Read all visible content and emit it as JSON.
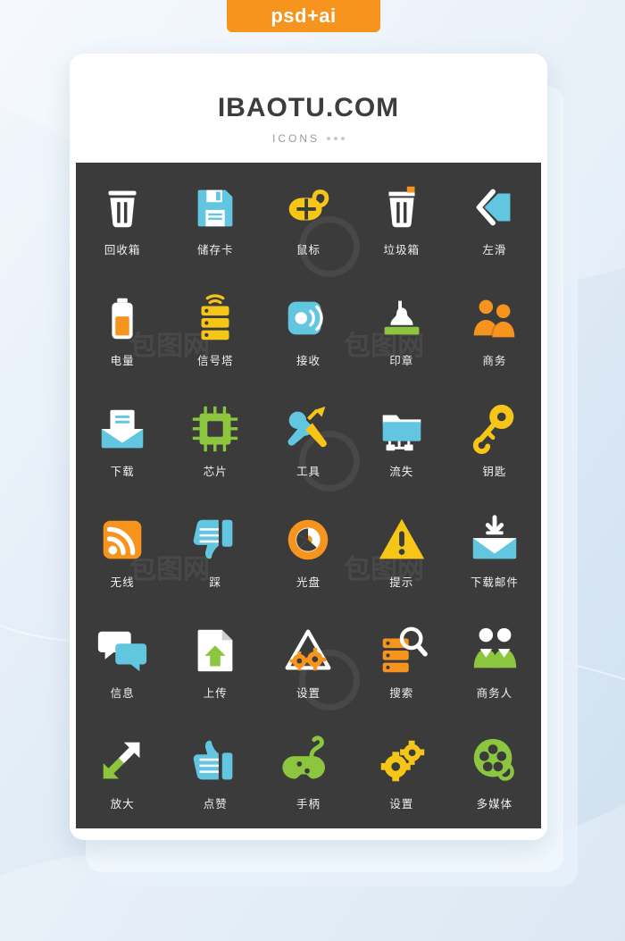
{
  "badge": {
    "label": "psd+ai"
  },
  "card": {
    "brand": "IBAOTU.COM",
    "subtitle": "ICONS"
  },
  "watermark": {
    "text": "包图网",
    "ring": "circle-watermark"
  },
  "colors": {
    "accent_orange": "#f7941e",
    "panel_dark": "#3b3b3b",
    "icon_blue": "#63c6e0",
    "icon_yellow": "#f5c518",
    "icon_green": "#8cc63f",
    "icon_orange": "#f7941e",
    "icon_white": "#ffffff",
    "page_bg": "#dfe9f5"
  },
  "icons": [
    {
      "label": "回收箱",
      "name": "recycle-bin-icon"
    },
    {
      "label": "储存卡",
      "name": "memory-card-icon"
    },
    {
      "label": "鼠标",
      "name": "mouse-icon"
    },
    {
      "label": "垃圾箱",
      "name": "trash-can-icon"
    },
    {
      "label": "左滑",
      "name": "swipe-left-icon"
    },
    {
      "label": "电量",
      "name": "battery-icon"
    },
    {
      "label": "信号塔",
      "name": "signal-tower-icon"
    },
    {
      "label": "接收",
      "name": "receive-signal-icon"
    },
    {
      "label": "印章",
      "name": "stamp-icon"
    },
    {
      "label": "商务",
      "name": "business-people-icon"
    },
    {
      "label": "下载",
      "name": "download-mail-icon"
    },
    {
      "label": "芯片",
      "name": "chip-icon"
    },
    {
      "label": "工具",
      "name": "tools-icon"
    },
    {
      "label": "流失",
      "name": "network-folder-icon"
    },
    {
      "label": "钥匙",
      "name": "key-icon"
    },
    {
      "label": "无线",
      "name": "wireless-rss-icon"
    },
    {
      "label": "踩",
      "name": "thumbs-down-icon"
    },
    {
      "label": "光盘",
      "name": "disc-icon"
    },
    {
      "label": "提示",
      "name": "warning-icon"
    },
    {
      "label": "下载邮件",
      "name": "download-envelope-icon"
    },
    {
      "label": "信息",
      "name": "messages-icon"
    },
    {
      "label": "上传",
      "name": "upload-file-icon"
    },
    {
      "label": "设置",
      "name": "settings-gears-icon"
    },
    {
      "label": "搜索",
      "name": "search-server-icon"
    },
    {
      "label": "商务人",
      "name": "businessman-icon"
    },
    {
      "label": "放大",
      "name": "enlarge-arrows-icon"
    },
    {
      "label": "点赞",
      "name": "thumbs-up-icon"
    },
    {
      "label": "手柄",
      "name": "gamepad-icon"
    },
    {
      "label": "设置",
      "name": "gears-icon"
    },
    {
      "label": "多媒体",
      "name": "film-reel-icon"
    }
  ]
}
